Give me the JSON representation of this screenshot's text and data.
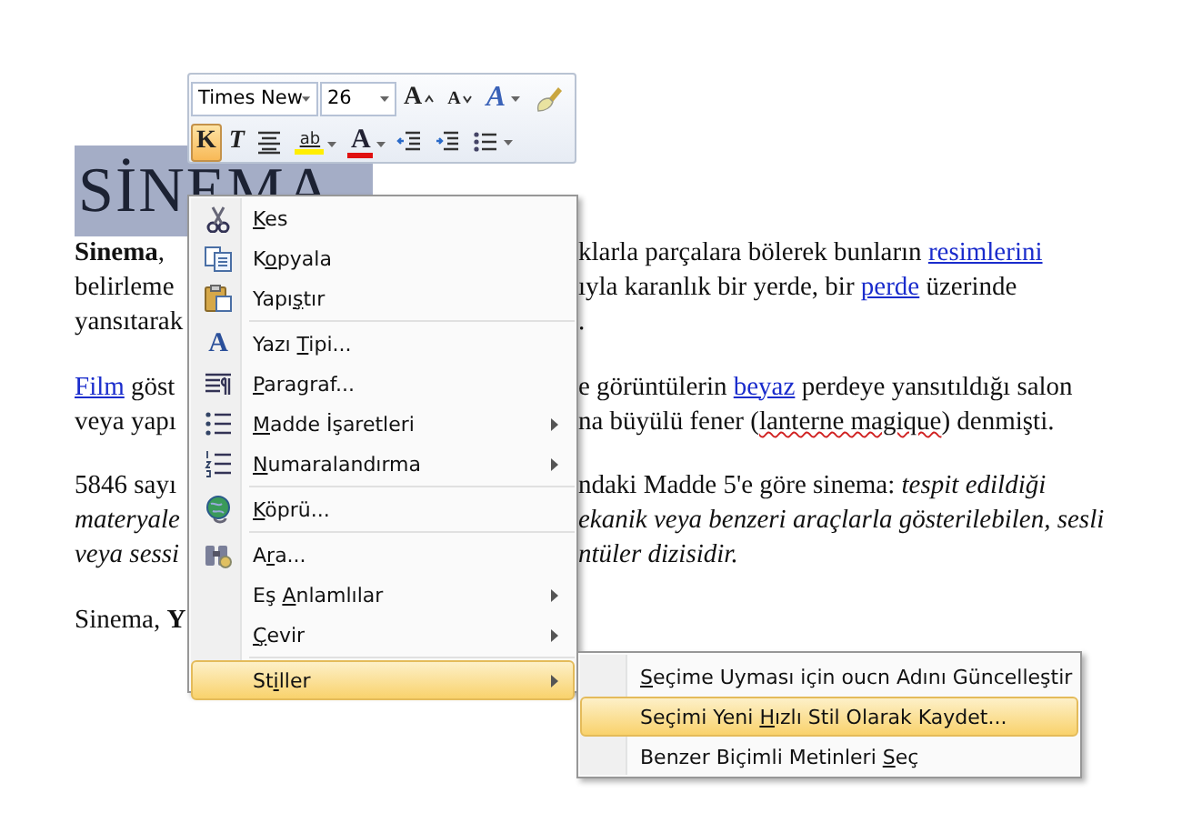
{
  "document": {
    "heading": {
      "text": "SİNEMA",
      "highlighted": true
    },
    "paragraphs": [
      [
        {
          "left": [
            {
              "text": "**Sinema**,"
            }
          ],
          "right": [
            {
              "text": "klarla parçalara bölerek bunların "
            },
            {
              "text": "resimlerini",
              "kind": "link"
            }
          ]
        },
        {
          "left": [
            {
              "text": "belirleme"
            }
          ],
          "right": [
            {
              "text": "ıyla karanlık bir yerde, bir "
            },
            {
              "text": "perde",
              "kind": "link"
            },
            {
              "text": " üzerinde"
            }
          ]
        },
        {
          "left": [
            {
              "text": "yansıtarak"
            }
          ],
          "right": [
            {
              "text": "."
            }
          ]
        }
      ],
      [
        {
          "left": [
            {
              "text": "Film",
              "kind": "link"
            },
            {
              "text": " göst"
            }
          ],
          "right": [
            {
              "text": "e görüntülerin "
            },
            {
              "text": "beyaz",
              "kind": "link"
            },
            {
              "text": " perdeye yansıtıldığı salon"
            }
          ]
        },
        {
          "left": [
            {
              "text": "veya yapı"
            }
          ],
          "right": [
            {
              "text": "na büyülü fener ("
            },
            {
              "text": "lanterne magique",
              "kind": "misspelled"
            },
            {
              "text": ") denmişti."
            }
          ]
        }
      ],
      [
        {
          "left": [
            {
              "text": "5846 sayı"
            }
          ],
          "right": [
            {
              "text": "ndaki Madde 5'e göre sinema: *tespit edildiği*"
            }
          ]
        },
        {
          "left": [
            {
              "text": "*materyale*"
            }
          ],
          "right": [
            {
              "text": "*ekanik veya benzeri araçlarla gösterilebilen, sesli*"
            }
          ]
        },
        {
          "left": [
            {
              "text": "*veya sessi*"
            }
          ],
          "right": [
            {
              "text": "*ntüler dizisidir.*"
            }
          ]
        }
      ],
      [
        {
          "left": [
            {
              "text": "Sinema, **Y**"
            }
          ]
        }
      ]
    ]
  },
  "mini_toolbar": {
    "top_row": [
      {
        "kind": "combo",
        "value": "Times New"
      },
      {
        "kind": "combo",
        "value": "26"
      },
      {
        "kind": "grow",
        "label": "A",
        "pressed": false
      },
      {
        "kind": "shrink",
        "label": "A",
        "pressed": false
      },
      {
        "kind": "styles",
        "label": "A",
        "dropdown": true,
        "pressed": false
      },
      {
        "kind": "painter",
        "pressed": false
      }
    ],
    "bottom_row": [
      {
        "kind": "bold",
        "label": "K",
        "pressed": true
      },
      {
        "kind": "italic",
        "label": "T",
        "pressed": false
      },
      {
        "kind": "center",
        "pressed": false
      },
      {
        "kind": "highlight",
        "label": "ab",
        "dropdown": true,
        "pressed": false
      },
      {
        "kind": "fontcolor",
        "label": "A",
        "dropdown": true,
        "pressed": false
      },
      {
        "kind": "outdent",
        "pressed": false
      },
      {
        "kind": "indent",
        "pressed": false
      },
      {
        "kind": "bullets",
        "dropdown": true,
        "pressed": false
      }
    ]
  },
  "context_menu": {
    "items": [
      {
        "key": "K",
        "after": "es",
        "selected": false
      },
      {
        "before": "K",
        "key": "o",
        "after": "pyala",
        "selected": false
      },
      {
        "before": "Yapı",
        "key": "ş",
        "after": "tır",
        "selected": false
      },
      {
        "kind": "separator"
      },
      {
        "icon_text": "A",
        "before": "Yazı ",
        "key": "T",
        "after": "ipi...",
        "selected": false
      },
      {
        "key": "P",
        "after": "aragraf...",
        "selected": false
      },
      {
        "key": "M",
        "after": "adde İşaretleri",
        "submenu": true,
        "selected": false
      },
      {
        "key": "N",
        "after": "umaralandırma",
        "submenu": true,
        "selected": false
      },
      {
        "kind": "separator"
      },
      {
        "key": "K",
        "after": "öprü...",
        "selected": false
      },
      {
        "kind": "separator"
      },
      {
        "before": "A",
        "key": "r",
        "after": "a...",
        "selected": false
      },
      {
        "before": "Eş ",
        "key": "A",
        "after": "nlamlılar",
        "submenu": true,
        "selected": false
      },
      {
        "key": "Ç",
        "after": "evir",
        "submenu": true,
        "selected": false
      },
      {
        "kind": "separator"
      },
      {
        "before": "St",
        "key": "i",
        "after": "ller",
        "submenu": true,
        "selected": true
      }
    ]
  },
  "submenu": {
    "items": [
      {
        "key": "S",
        "after": "eçime Uyması için oucn Adını Güncelleştir",
        "selected": false
      },
      {
        "before": "Seçimi Yeni ",
        "key": "H",
        "after": "ızlı Stil Olarak Kaydet...",
        "selected": true
      },
      {
        "before": "Benzer Biçimli Metinleri ",
        "key": "S",
        "after": "eç",
        "selected": false
      }
    ]
  }
}
